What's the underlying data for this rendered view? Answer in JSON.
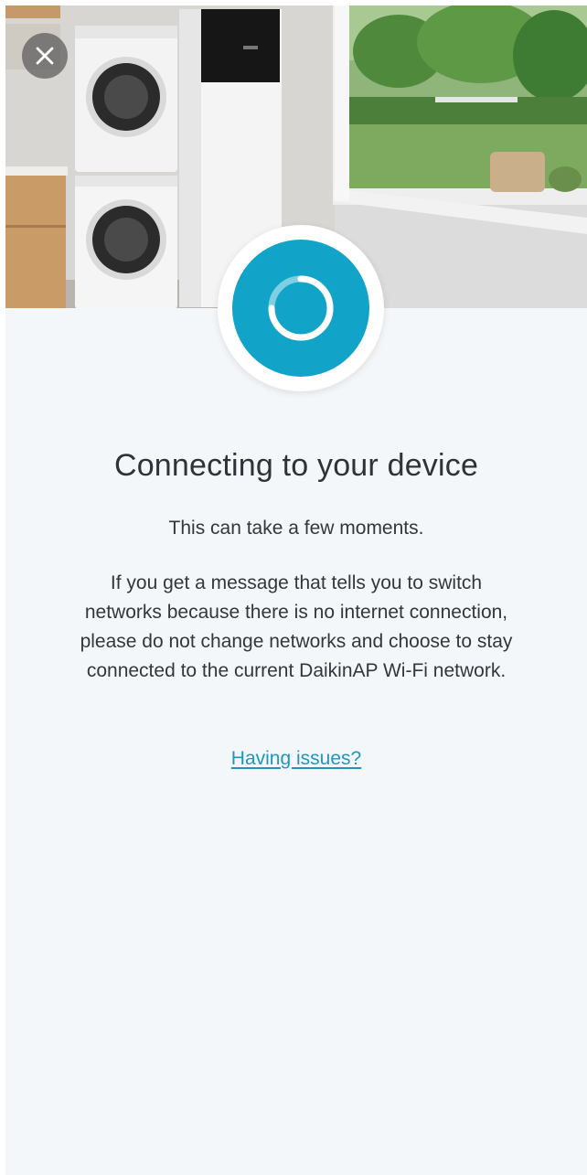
{
  "header": {
    "close_icon": "close-icon",
    "hero_image": "laundry-room-heat-pump-illustration"
  },
  "status": {
    "spinner_icon": "loading-spinner-icon",
    "accent_color": "#12a3c9",
    "title": "Connecting to your device",
    "subtitle": "This can take a few moments.",
    "message": "If you get a message that tells you to switch networks because there is no internet connection, please do not change networks and choose to stay connected to the current DaikinAP Wi-Fi network.",
    "help_link": "Having issues?"
  }
}
